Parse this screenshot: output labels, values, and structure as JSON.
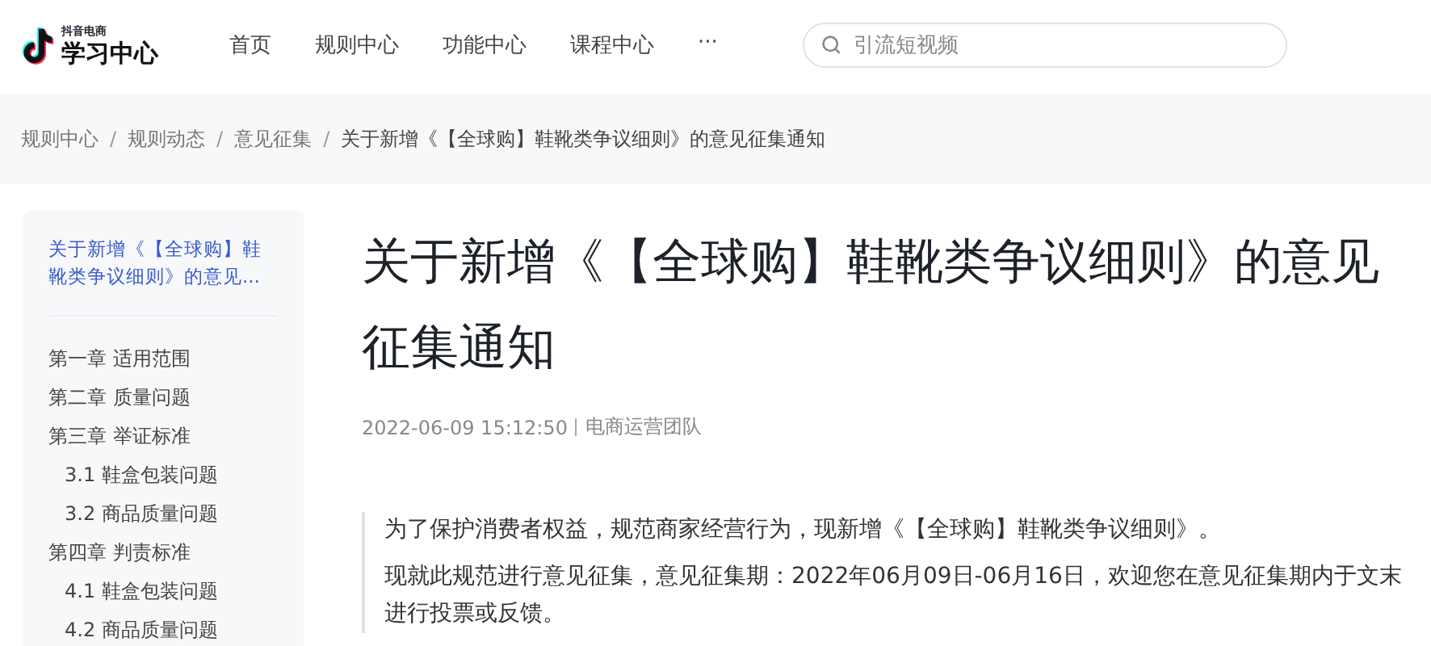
{
  "logo": {
    "small_text": "抖音电商",
    "name": "学习中心"
  },
  "nav": [
    {
      "label": "首页",
      "selected": false
    },
    {
      "label": "规则中心",
      "selected": false
    },
    {
      "label": "功能中心",
      "selected": false
    },
    {
      "label": "课程中心",
      "selected": false
    },
    {
      "label": "···",
      "selected": false
    }
  ],
  "search": {
    "placeholder": "引流短视频"
  },
  "breadcrumbs": [
    "规则中心",
    "规则动态",
    "意见征集",
    "关于新增《【全球购】鞋靴类争议细则》的意见征集通知"
  ],
  "breadcrumb_separator": "/",
  "toc": {
    "title": "关于新增《【全球购】鞋靴类争议细则》的意见...",
    "title_selected": true,
    "items": [
      {
        "label": "第一章 适用范围",
        "selected": false
      },
      {
        "label": "第二章 质量问题",
        "selected": false
      },
      {
        "label": "第三章 举证标准",
        "selected": false,
        "children": [
          {
            "label": "3.1 鞋盒包装问题",
            "selected": false
          },
          {
            "label": "3.2 商品质量问题",
            "selected": false
          }
        ]
      },
      {
        "label": "第四章 判责标准",
        "selected": false,
        "children": [
          {
            "label": "4.1 鞋盒包装问题",
            "selected": false
          },
          {
            "label": "4.2 商品质量问题",
            "selected": false
          }
        ]
      }
    ]
  },
  "article": {
    "title": "关于新增《【全球购】鞋靴类争议细则》的意见征集通知",
    "date": "2022-06-09 15:12:50",
    "author": "电商运营团队",
    "paragraphs": [
      "为了保护消费者权益，规范商家经营行为，现新增《【全球购】鞋靴类争议细则》。",
      "现就此规范进行意见征集，意见征集期：2022年06月09日-06月16日，欢迎您在意见征集期内于文末进行投票或反馈。"
    ]
  }
}
